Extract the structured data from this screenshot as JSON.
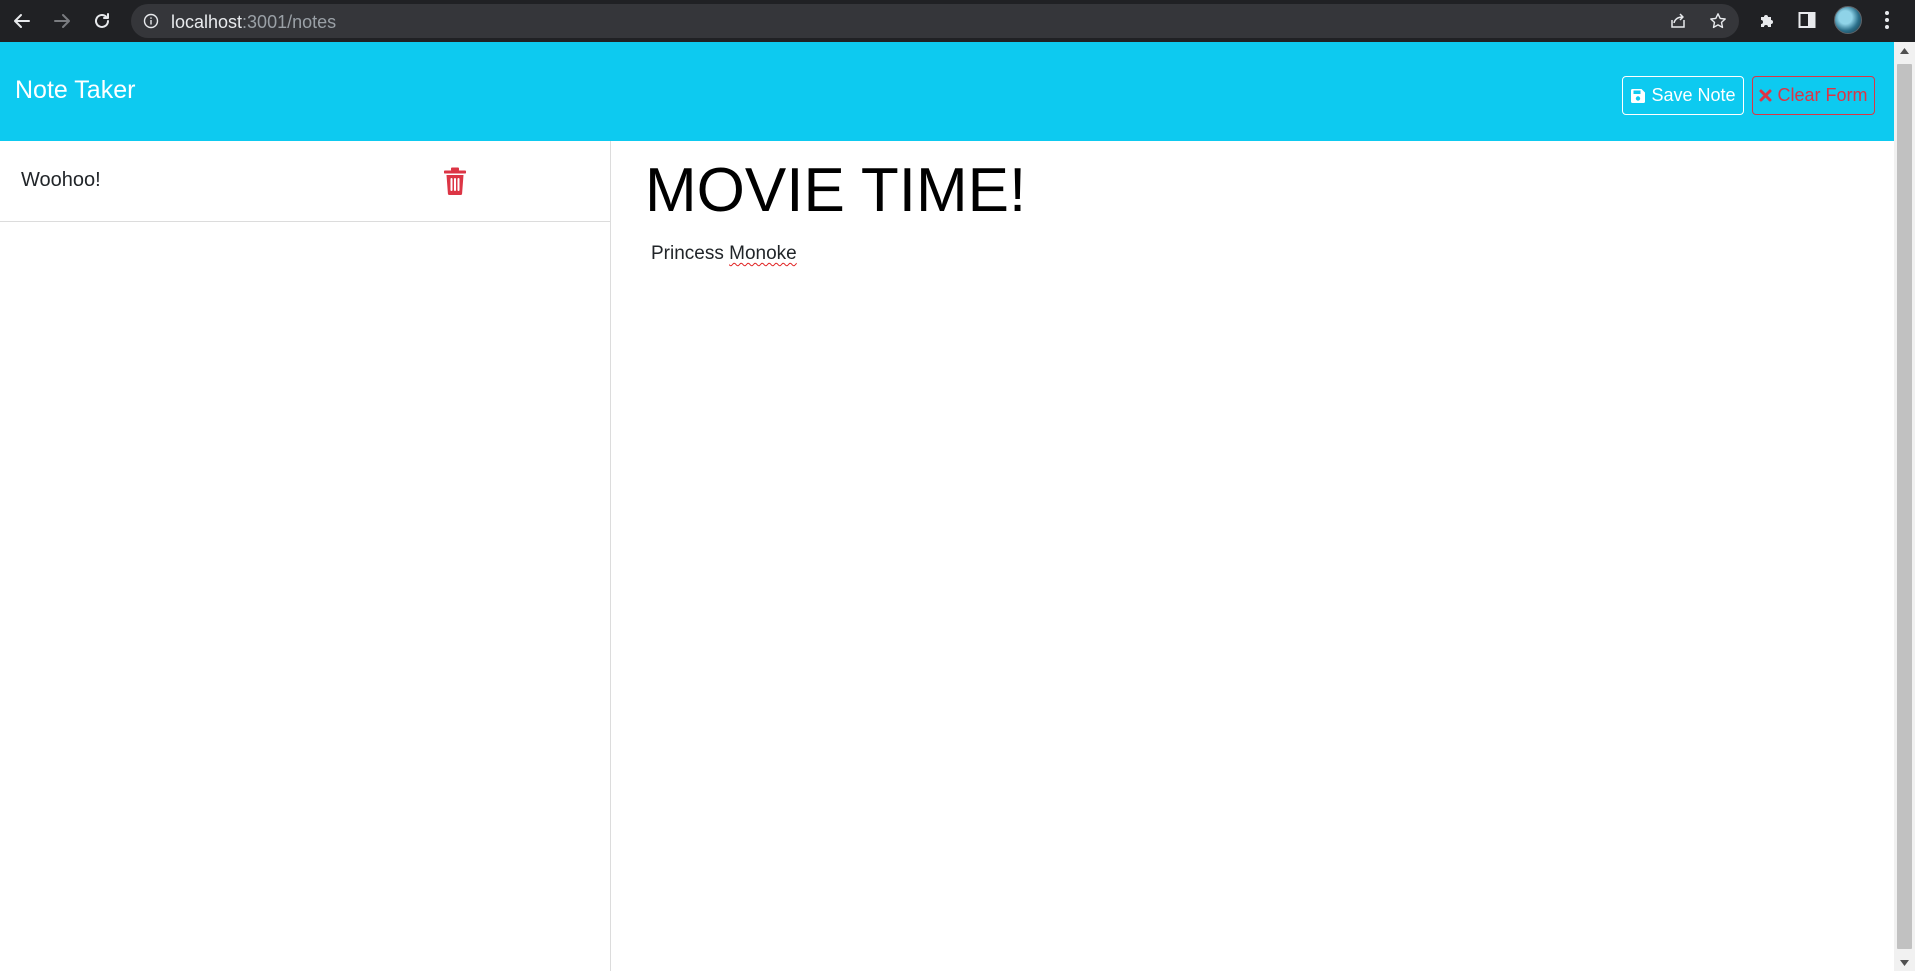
{
  "browser": {
    "url_host": "localhost",
    "url_path": ":3001/notes",
    "icons": [
      "back-icon",
      "forward-icon",
      "reload-icon",
      "info-icon",
      "share-icon",
      "star-icon",
      "extensions-icon",
      "side-panel-icon",
      "avatar",
      "menu-icon"
    ]
  },
  "app": {
    "title": "Note Taker",
    "save_label": "Save Note",
    "clear_label": "Clear Form",
    "colors": {
      "header": "#0dcaf0",
      "danger": "#dc3545"
    }
  },
  "notes": [
    {
      "title": "Woohoo!"
    }
  ],
  "editor": {
    "title": "MOVIE TIME!",
    "text_word1": "Princess",
    "text_word2": "Monoke"
  }
}
